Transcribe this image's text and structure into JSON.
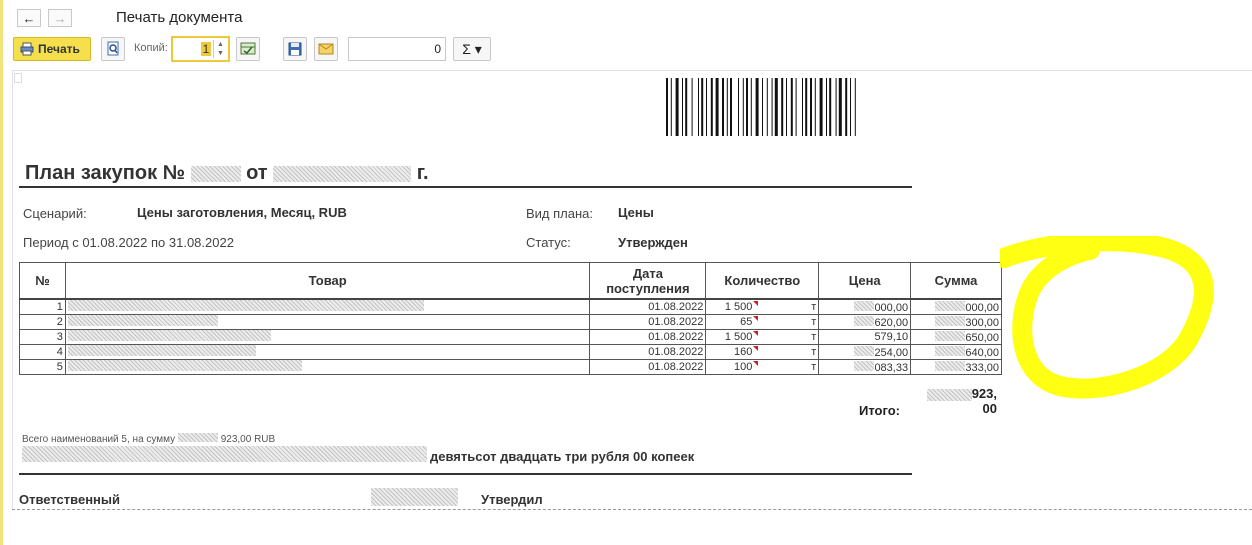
{
  "window": {
    "title": "Печать документа"
  },
  "toolbar": {
    "print_label": "Печать",
    "copies_label": "Копий:",
    "copies_value": "1",
    "field_value": "0",
    "sigma_label": "Σ ▾"
  },
  "document": {
    "title_prefix": "План закупок №",
    "title_from": "от",
    "title_suffix": "г.",
    "scenario_label": "Сценарий:",
    "scenario_value": "Цены заготовления, Месяц, RUB",
    "plan_type_label": "Вид плана:",
    "plan_type_value": "Цены",
    "period_text": "Период с 01.08.2022 по 31.08.2022",
    "status_label": "Статус:",
    "status_value": "Утвержден",
    "table": {
      "headers": [
        "№",
        "Товар",
        "Дата поступления",
        "Количество",
        "Цена",
        "Сумма"
      ],
      "rows": [
        {
          "n": "1",
          "date": "01.08.2022",
          "qty": "1 500",
          "unit": "т",
          "price": "000,00",
          "sum": "000,00"
        },
        {
          "n": "2",
          "date": "01.08.2022",
          "qty": "65",
          "unit": "т",
          "price": "620,00",
          "sum": "300,00"
        },
        {
          "n": "3",
          "date": "01.08.2022",
          "qty": "1 500",
          "unit": "т",
          "price": "579,10",
          "sum": "650,00"
        },
        {
          "n": "4",
          "date": "01.08.2022",
          "qty": "160",
          "unit": "т",
          "price": "254,00",
          "sum": "640,00"
        },
        {
          "n": "5",
          "date": "01.08.2022",
          "qty": "100",
          "unit": "т",
          "price": "083,33",
          "sum": "333,00"
        }
      ]
    },
    "total_label": "Итого:",
    "total_value_line1": "923,",
    "total_value_line2": "00",
    "summary_prefix": "Всего наименований 5, на сумму",
    "summary_suffix": "923,00 RUB",
    "amount_words": "девятьсот двадцать три рубля 00 копеек",
    "responsible_label": "Ответственный",
    "approved_label": "Утвердил"
  },
  "colors": {
    "print_button": "#f5df4d",
    "highlight_circle": "#ffff00",
    "redacted": "#d6d6d6"
  }
}
